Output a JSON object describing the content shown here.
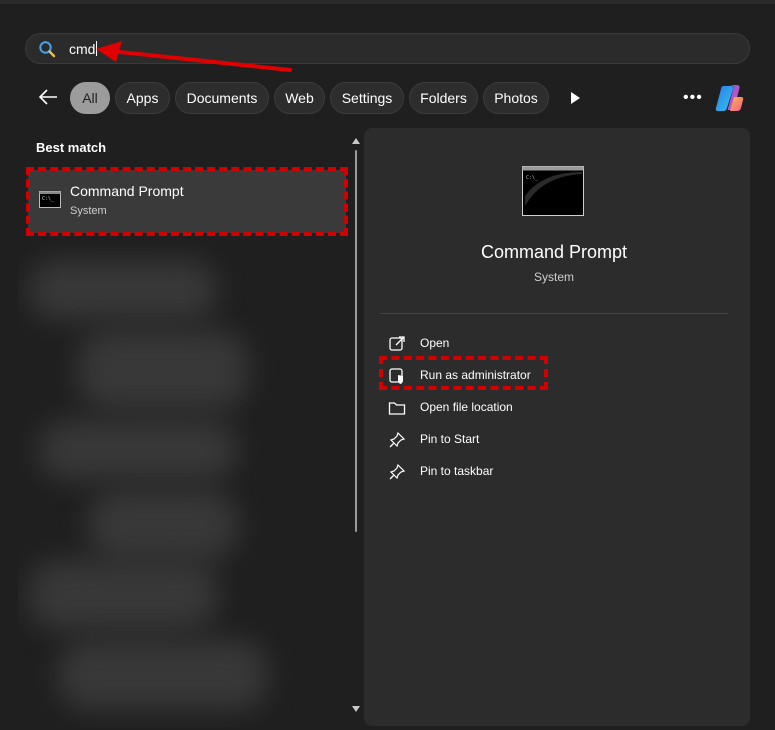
{
  "search": {
    "query": "cmd"
  },
  "filters": {
    "tabs": [
      {
        "label": "All",
        "active": true
      },
      {
        "label": "Apps"
      },
      {
        "label": "Documents"
      },
      {
        "label": "Web"
      },
      {
        "label": "Settings"
      },
      {
        "label": "Folders"
      },
      {
        "label": "Photos"
      }
    ],
    "icons": {
      "back": "arrow-left-icon",
      "more": "more-options-icon",
      "play": "play-icon",
      "copilot": "copilot-icon"
    }
  },
  "results": {
    "section_label": "Best match",
    "best_match": {
      "title": "Command Prompt",
      "subtitle": "System",
      "icon": "command-prompt-icon"
    }
  },
  "details": {
    "title": "Command Prompt",
    "subtitle": "System",
    "actions": [
      {
        "label": "Open",
        "icon": "open-icon"
      },
      {
        "label": "Run as administrator",
        "icon": "shield-icon"
      },
      {
        "label": "Open file location",
        "icon": "folder-icon"
      },
      {
        "label": "Pin to Start",
        "icon": "pin-icon"
      },
      {
        "label": "Pin to taskbar",
        "icon": "pin-icon"
      }
    ]
  },
  "colors": {
    "highlight": "#d40000",
    "arrow": "#e00000",
    "background": "#1f1f1f",
    "panel": "#2c2c2c"
  }
}
